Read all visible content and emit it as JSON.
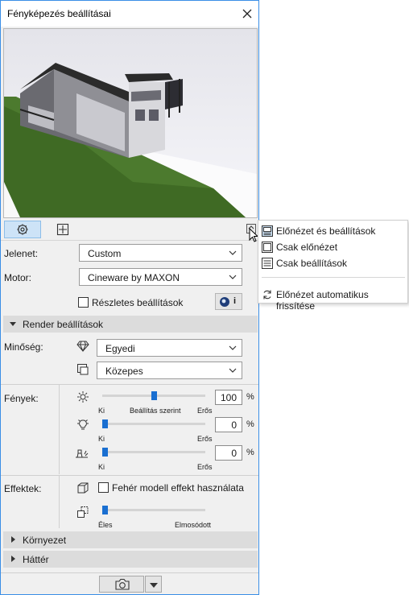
{
  "window": {
    "title": "Fényképezés beállításai",
    "close_icon": "close-icon"
  },
  "toolbar": {
    "tabs": [
      "settings-icon",
      "preview-size-icon"
    ],
    "menu_toggle_icon": "menu-toggle-icon"
  },
  "scene": {
    "label": "Jelenet:",
    "value": "Custom"
  },
  "engine": {
    "label": "Motor:",
    "value": "Cineware by MAXON",
    "info_button": "i"
  },
  "detailed_settings": {
    "label": "Részletes beállítások",
    "checked": false
  },
  "render_section": {
    "title": "Render beállítások",
    "expanded": true
  },
  "quality": {
    "label": "Minőség:",
    "preset": "Egyedi",
    "level": "Közepes"
  },
  "lights": {
    "label": "Fények:",
    "sun": {
      "value": "100",
      "unit": "%",
      "left": "Ki",
      "mid": "Beállítás szerint",
      "right": "Erős",
      "level": 0.5
    },
    "lamps": {
      "value": "0",
      "unit": "%",
      "left": "Ki",
      "right": "Erős",
      "level": 0.0
    },
    "ambient": {
      "value": "0",
      "unit": "%",
      "left": "Ki",
      "right": "Erős",
      "level": 0.0
    }
  },
  "effects": {
    "label": "Effektek:",
    "white_model": "Fehér modell effekt használata",
    "white_model_checked": false,
    "blur": {
      "left": "Éles",
      "right": "Elmosódott",
      "level": 0.0
    }
  },
  "sections": [
    {
      "title": "Környezet",
      "expanded": false
    },
    {
      "title": "Háttér",
      "expanded": false
    }
  ],
  "footer": {
    "camera_icon": "camera-icon",
    "dropdown_icon": "dropdown-icon"
  },
  "menu": {
    "items": [
      {
        "label": "Előnézet és beállítások",
        "icon": "preview-settings-icon",
        "selected": true
      },
      {
        "label": "Csak előnézet",
        "icon": "preview-only-icon",
        "selected": false
      },
      {
        "label": "Csak beállítások",
        "icon": "settings-only-icon",
        "selected": false
      }
    ],
    "auto_refresh": {
      "label": "Előnézet automatikus frissítése",
      "icon": "refresh-icon"
    }
  },
  "colors": {
    "accent": "#1a6fd1",
    "window_border": "#3a8ee6",
    "section_bg": "#dcdcdc",
    "grass": "#4c7a2e"
  }
}
